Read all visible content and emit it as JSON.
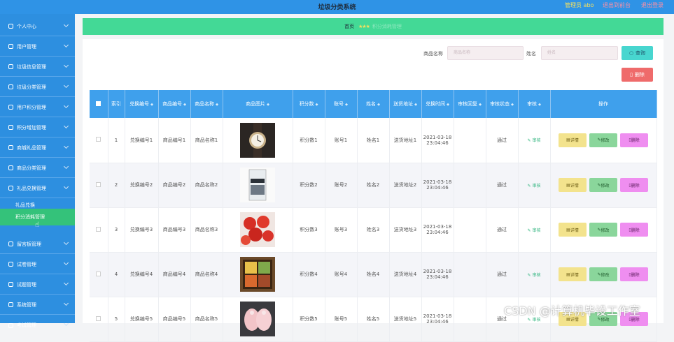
{
  "header": {
    "title": "垃圾分类系统",
    "admin": "管理员 abo",
    "link1": "退出到前台",
    "link2": "退出登录"
  },
  "sidebar": {
    "items": [
      {
        "label": "个人中心"
      },
      {
        "label": "用户管理"
      },
      {
        "label": "垃圾信息管理"
      },
      {
        "label": "垃圾分类管理"
      },
      {
        "label": "用户积分管理"
      },
      {
        "label": "积分增加管理"
      },
      {
        "label": "商城礼品管理"
      },
      {
        "label": "商品分类管理"
      },
      {
        "label": "礼品兑换管理"
      }
    ],
    "subitems": [
      {
        "label": "礼品兑换"
      },
      {
        "label": "积分消耗管理"
      }
    ],
    "items2": [
      {
        "label": "留言板管理"
      },
      {
        "label": "试卷管理"
      },
      {
        "label": "试题管理"
      },
      {
        "label": "系统管理"
      },
      {
        "label": "考试管理"
      }
    ]
  },
  "breadcrumb": {
    "home": "首页",
    "stars": "★★★",
    "current": "积分消耗管理"
  },
  "search": {
    "name_label": "商品名称",
    "name_placeholder": "商品名称",
    "user_label": "姓名",
    "user_placeholder": "姓名",
    "search_btn": "查询",
    "delete_btn": "删除"
  },
  "table": {
    "headers": [
      "索引",
      "兑换编号",
      "商品编号",
      "商品名称",
      "商品图片",
      "积分数",
      "账号",
      "姓名",
      "送货地址",
      "兑换时间",
      "审核回复",
      "审核状态",
      "审核",
      "操作"
    ],
    "sort_marks": "◆",
    "rows": [
      {
        "idx": "1",
        "exchange_no": "兑换编号1",
        "goods_no": "商品编号1",
        "goods_name": "商品名称1",
        "points": "积分数1",
        "account": "账号1",
        "name": "姓名1",
        "address": "送货地址1",
        "time": "2021-03-18 23:04:46",
        "reply": "",
        "status": "通过",
        "audit": "审核",
        "image": "watch"
      },
      {
        "idx": "2",
        "exchange_no": "兑换编号2",
        "goods_no": "商品编号2",
        "goods_name": "商品名称2",
        "points": "积分数2",
        "account": "账号2",
        "name": "姓名2",
        "address": "送货地址2",
        "time": "2021-03-18 23:04:46",
        "reply": "",
        "status": "通过",
        "audit": "审核",
        "image": "book"
      },
      {
        "idx": "3",
        "exchange_no": "兑换编号3",
        "goods_no": "商品编号3",
        "goods_name": "商品名称3",
        "points": "积分数3",
        "account": "账号3",
        "name": "姓名3",
        "address": "送货地址3",
        "time": "2021-03-18 23:04:46",
        "reply": "",
        "status": "通过",
        "audit": "审核",
        "image": "fruit"
      },
      {
        "idx": "4",
        "exchange_no": "兑换编号4",
        "goods_no": "商品编号4",
        "goods_name": "商品名称4",
        "points": "积分数4",
        "account": "账号4",
        "name": "姓名4",
        "address": "送货地址4",
        "time": "2021-03-18 23:04:46",
        "reply": "",
        "status": "通过",
        "audit": "审核",
        "image": "lunchbox"
      },
      {
        "idx": "5",
        "exchange_no": "兑换编号5",
        "goods_no": "商品编号5",
        "goods_name": "商品名称5",
        "points": "积分数5",
        "account": "账号5",
        "name": "姓名5",
        "address": "送货地址5",
        "time": "2021-03-18 23:04:46",
        "reply": "",
        "status": "通过",
        "audit": "审核",
        "image": "shoes"
      }
    ],
    "ops": {
      "detail": "详情",
      "edit": "修改",
      "delete": "删除"
    }
  },
  "watermark": "CSDN @计算机毕设工作室"
}
